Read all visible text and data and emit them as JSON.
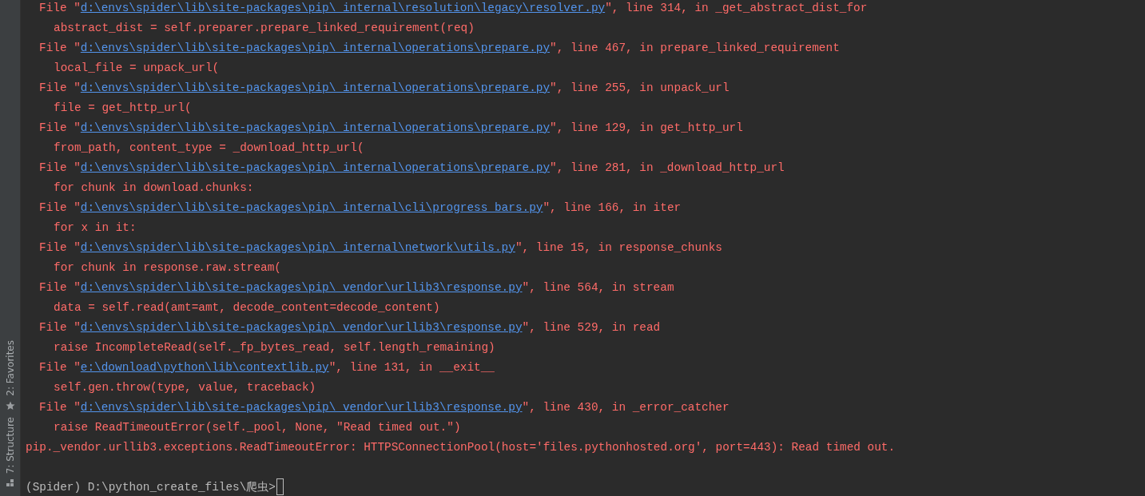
{
  "sidebar": {
    "tools": [
      {
        "kind": "favorites",
        "label": "2: Favorites"
      },
      {
        "kind": "structure",
        "label": "7: Structure"
      }
    ]
  },
  "terminal": {
    "frames": [
      {
        "before": "File \"",
        "path": "d:\\envs\\spider\\lib\\site-packages\\pip\\_internal\\resolution\\legacy\\resolver.py",
        "after": "\", line 314, in _get_abstract_dist_for",
        "code": "abstract_dist = self.preparer.prepare_linked_requirement(req)"
      },
      {
        "before": "File \"",
        "path": "d:\\envs\\spider\\lib\\site-packages\\pip\\_internal\\operations\\prepare.py",
        "after": "\", line 467, in prepare_linked_requirement",
        "code": "local_file = unpack_url("
      },
      {
        "before": "File \"",
        "path": "d:\\envs\\spider\\lib\\site-packages\\pip\\_internal\\operations\\prepare.py",
        "after": "\", line 255, in unpack_url",
        "code": "file = get_http_url("
      },
      {
        "before": "File \"",
        "path": "d:\\envs\\spider\\lib\\site-packages\\pip\\_internal\\operations\\prepare.py",
        "after": "\", line 129, in get_http_url",
        "code": "from_path, content_type = _download_http_url("
      },
      {
        "before": "File \"",
        "path": "d:\\envs\\spider\\lib\\site-packages\\pip\\_internal\\operations\\prepare.py",
        "after": "\", line 281, in _download_http_url",
        "code": "for chunk in download.chunks:"
      },
      {
        "before": "File \"",
        "path": "d:\\envs\\spider\\lib\\site-packages\\pip\\_internal\\cli\\progress_bars.py",
        "after": "\", line 166, in iter",
        "code": "for x in it:"
      },
      {
        "before": "File \"",
        "path": "d:\\envs\\spider\\lib\\site-packages\\pip\\_internal\\network\\utils.py",
        "after": "\", line 15, in response_chunks",
        "code": "for chunk in response.raw.stream("
      },
      {
        "before": "File \"",
        "path": "d:\\envs\\spider\\lib\\site-packages\\pip\\_vendor\\urllib3\\response.py",
        "after": "\", line 564, in stream",
        "code": "data = self.read(amt=amt, decode_content=decode_content)"
      },
      {
        "before": "File \"",
        "path": "d:\\envs\\spider\\lib\\site-packages\\pip\\_vendor\\urllib3\\response.py",
        "after": "\", line 529, in read",
        "code": "raise IncompleteRead(self._fp_bytes_read, self.length_remaining)"
      },
      {
        "before": "File \"",
        "path": "e:\\download\\python\\lib\\contextlib.py",
        "after": "\", line 131, in __exit__",
        "code": "self.gen.throw(type, value, traceback)"
      },
      {
        "before": "File \"",
        "path": "d:\\envs\\spider\\lib\\site-packages\\pip\\_vendor\\urllib3\\response.py",
        "after": "\", line 430, in _error_catcher",
        "code": "raise ReadTimeoutError(self._pool, None, \"Read timed out.\")"
      }
    ],
    "error": "pip._vendor.urllib3.exceptions.ReadTimeoutError: HTTPSConnectionPool(host='files.pythonhosted.org', port=443): Read timed out.",
    "prompt": "(Spider) D:\\python_create_files\\爬虫>"
  }
}
